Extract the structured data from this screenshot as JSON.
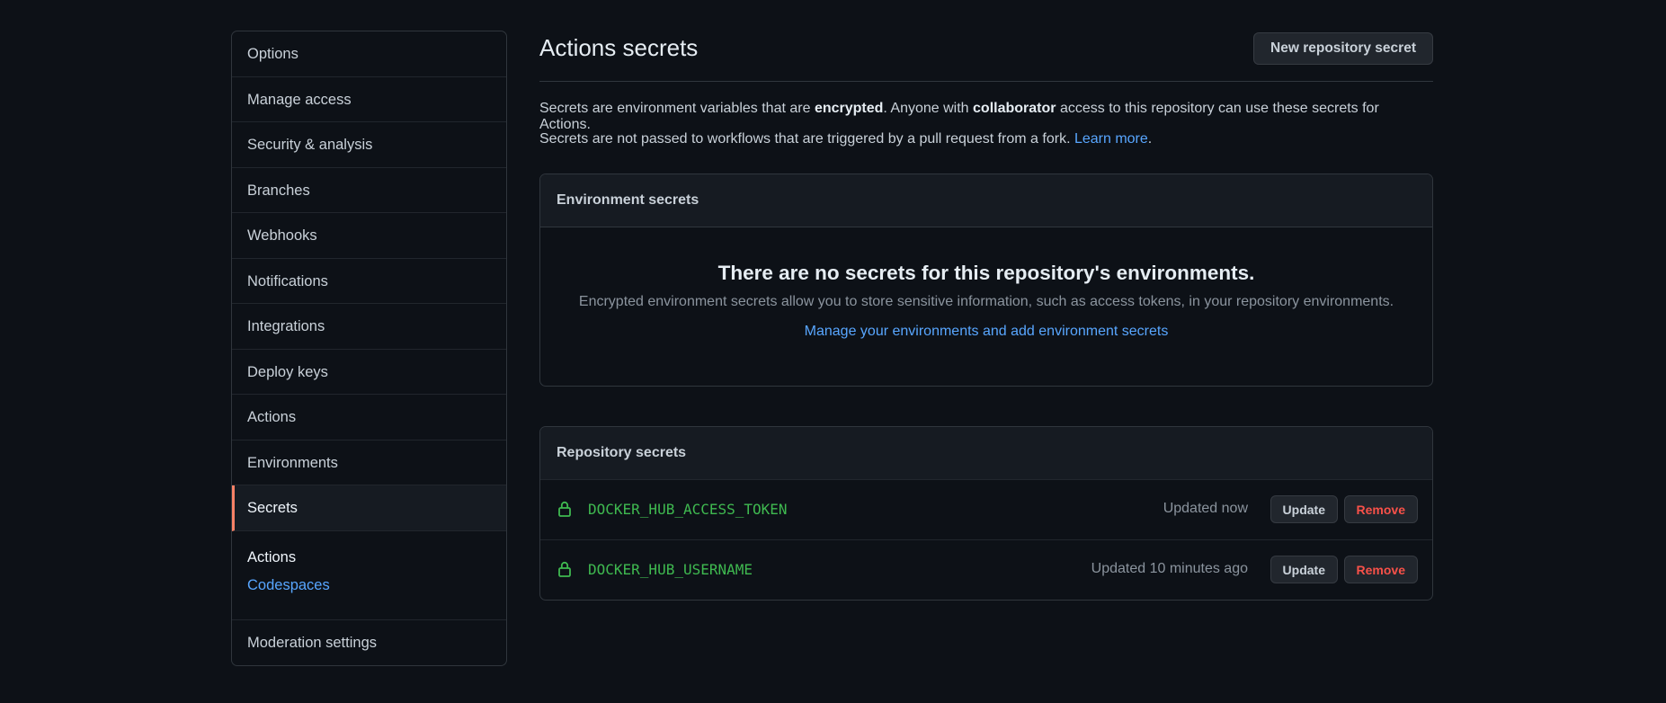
{
  "sidebar": {
    "items": [
      {
        "label": "Options"
      },
      {
        "label": "Manage access"
      },
      {
        "label": "Security & analysis"
      },
      {
        "label": "Branches"
      },
      {
        "label": "Webhooks"
      },
      {
        "label": "Notifications"
      },
      {
        "label": "Integrations"
      },
      {
        "label": "Deploy keys"
      },
      {
        "label": "Actions"
      },
      {
        "label": "Environments"
      },
      {
        "label": "Secrets",
        "active": true
      }
    ],
    "group": {
      "title": "Actions",
      "link": "Codespaces"
    },
    "last_item": "Moderation settings"
  },
  "main": {
    "title": "Actions secrets",
    "new_button": "New repository secret",
    "description": {
      "line1_a": "Secrets are environment variables that are ",
      "line1_b": "encrypted",
      "line1_c": ". Anyone with ",
      "line1_d": "collaborator",
      "line1_e": " access to this repository can use these secrets for Actions.",
      "line2_a": "Secrets are not passed to workflows that are triggered by a pull request from a fork. ",
      "line2_link": "Learn more",
      "line2_end": "."
    },
    "environment_secrets": {
      "header": "Environment secrets",
      "empty_title": "There are no secrets for this repository's environments.",
      "empty_desc": "Encrypted environment secrets allow you to store sensitive information, such as access tokens, in your repository environments.",
      "link": "Manage your environments and add environment secrets"
    },
    "repository_secrets": {
      "header": "Repository secrets",
      "rows": [
        {
          "name": "DOCKER_HUB_ACCESS_TOKEN",
          "updated": "Updated now",
          "update": "Update",
          "remove": "Remove"
        },
        {
          "name": "DOCKER_HUB_USERNAME",
          "updated": "Updated 10 minutes ago",
          "update": "Update",
          "remove": "Remove"
        }
      ]
    }
  },
  "colors": {
    "background": "#0d1117",
    "link": "#58a6ff",
    "secret_name": "#3fb950",
    "danger": "#f85149",
    "active_indicator": "#f78166"
  },
  "icons": {
    "lock": "lock-icon"
  }
}
